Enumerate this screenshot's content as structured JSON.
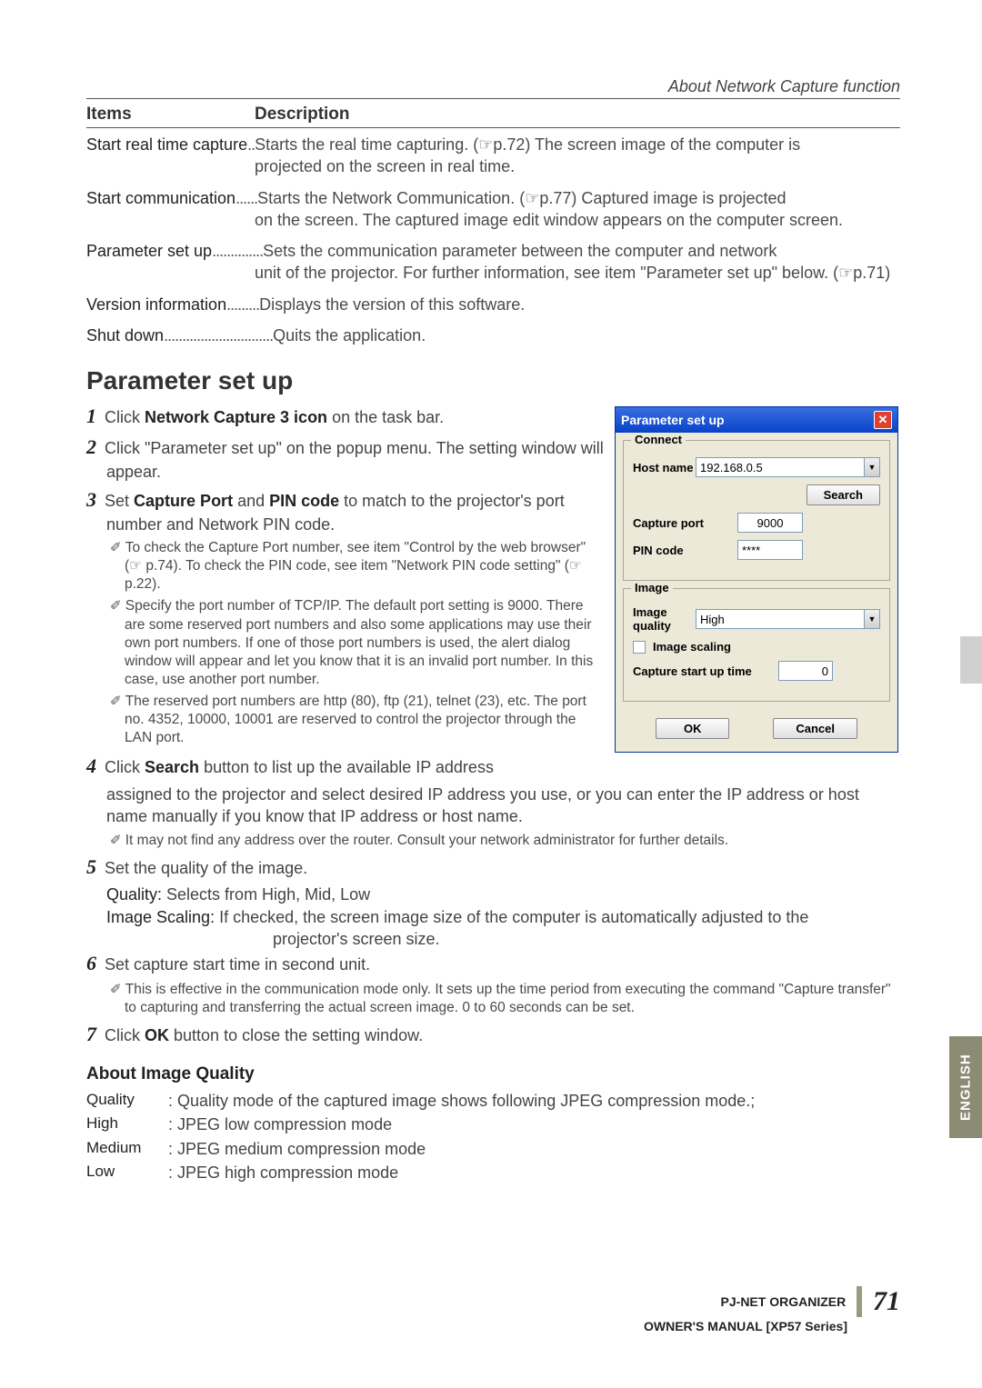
{
  "header": {
    "breadcrumb": "About Network Capture function"
  },
  "table": {
    "head_items": "Items",
    "head_desc": "Description",
    "rows": [
      {
        "label": "Start real time capture",
        "dots": "..",
        "desc": "Starts the real time capturing. (☞p.72) The screen image of the computer is",
        "cont": "projected on the screen in real time."
      },
      {
        "label": "Start communication",
        "dots": "......",
        "desc": "Starts the Network Communication. (☞p.77) Captured image is projected",
        "cont": "on the screen. The captured image edit window appears on the computer screen."
      },
      {
        "label": "Parameter set up",
        "dots": "..............",
        "desc": "Sets the communication parameter between the computer and network",
        "cont": "unit of the projector. For further information, see item \"Parameter set up\" below. (☞p.71)"
      },
      {
        "label": "Version information",
        "dots": ".........",
        "desc": "Displays the version of this software.",
        "cont": ""
      },
      {
        "label": "Shut down",
        "dots": "..............................",
        "desc": "Quits the application.",
        "cont": ""
      }
    ]
  },
  "section_title": "Parameter set up",
  "steps": {
    "s1_a": "Click ",
    "s1_b": "Network Capture 3 icon",
    "s1_c": " on the task bar.",
    "s2": "Click \"Parameter set up\" on the popup menu. The setting window will appear.",
    "s3_a": "Set ",
    "s3_b": "Capture Port",
    "s3_c": " and ",
    "s3_d": "PIN code",
    "s3_e": " to match to the projector's port number and Network PIN code.",
    "n1": "To check the Capture Port number,  see item \"Control by the web browser\" (☞ p.74). To check the PIN code, see item \"Network PIN code setting\" (☞ p.22).",
    "n2": "Specify the port number of TCP/IP. The default port setting is 9000. There are some reserved port numbers and also some applications may use their own port numbers. If one of those port numbers is used, the alert dialog window will appear and let you know that it is an invalid port number. In this case, use another port number.",
    "n3": "The reserved port numbers are http (80), ftp (21), telnet (23), etc. The port no. 4352, 10000, 10001 are reserved to control the projector through the LAN port.",
    "s4_a": "Click ",
    "s4_b": "Search",
    "s4_c": " button to list up the available IP address",
    "s4_cont": "assigned to the projector and select desired IP address you use, or you can enter the IP address or host name manually if you know that IP address or host name.",
    "n4": "It may not find any address over the router. Consult your network administrator for further details.",
    "s5": "Set the quality of the image.",
    "s5_q": "Quality: ",
    "s5_q_desc": "Selects from High, Mid, Low",
    "s5_is": "Image Scaling: ",
    "s5_is_desc": "If checked, the screen image size of the computer is automatically adjusted to the",
    "s5_is_cont": "projector's screen size.",
    "s6": "Set capture start time in second unit.",
    "n6": "This is effective in the communication mode only. It sets up the time period from executing the command \"Capture transfer\" to capturing and transferring the actual screen image. 0 to 60 seconds can be set.",
    "s7_a": "Click ",
    "s7_b": "OK",
    "s7_c": " button to close the setting window."
  },
  "aboutiq": {
    "title": "About Image Quality",
    "rows": [
      {
        "label": "Quality",
        "desc": ": Quality mode of the captured image shows following JPEG compression mode.;"
      },
      {
        "label": "High",
        "desc": ": JPEG low compression mode"
      },
      {
        "label": "Medium",
        "desc": ": JPEG medium compression mode"
      },
      {
        "label": "Low",
        "desc": ": JPEG high compression mode"
      }
    ]
  },
  "dialog": {
    "title": "Parameter set up",
    "close": "✕",
    "group_connect": "Connect",
    "hostname_label": "Host name",
    "hostname_value": "192.168.0.5",
    "search_btn": "Search",
    "captureport_label": "Capture port",
    "captureport_value": "9000",
    "pin_label": "PIN code",
    "pin_value": "****",
    "group_image": "Image",
    "iq_label": "Image quality",
    "iq_value": "High",
    "scaling_label": "Image scaling",
    "starttime_label": "Capture start up time",
    "starttime_value": "0",
    "ok": "OK",
    "cancel": "Cancel"
  },
  "sidetab": "ENGLISH",
  "footer": {
    "title": "PJ-NET ORGANIZER",
    "sub": "OWNER'S MANUAL [XP57 Series]",
    "page": "71"
  }
}
